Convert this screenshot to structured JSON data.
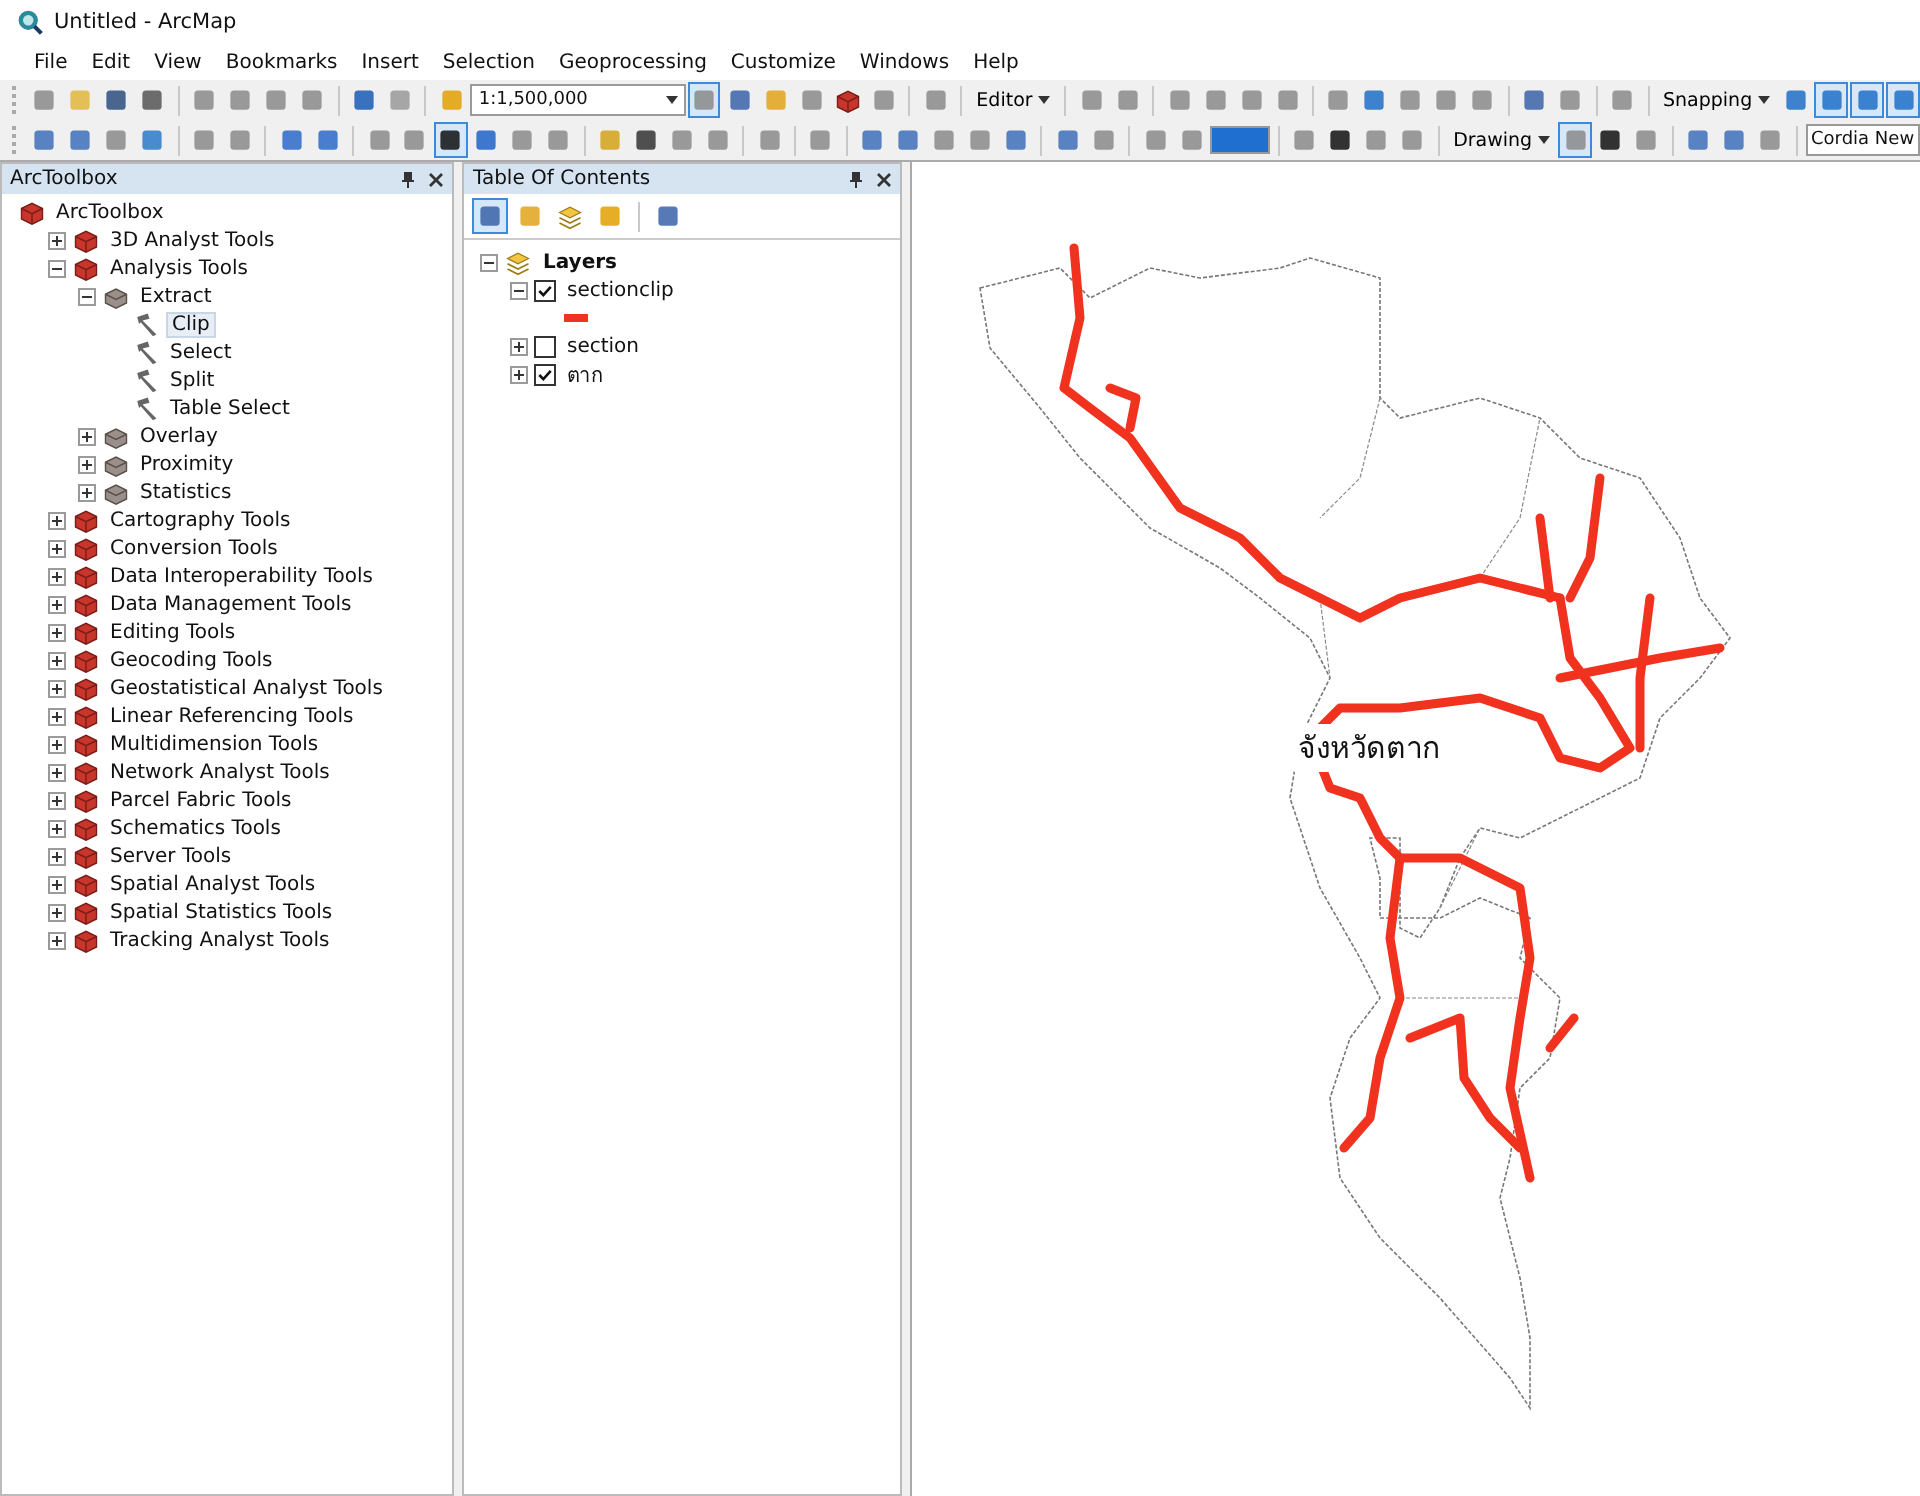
{
  "window": {
    "title": "Untitled - ArcMap"
  },
  "menu": [
    "File",
    "Edit",
    "View",
    "Bookmarks",
    "Insert",
    "Selection",
    "Geoprocessing",
    "Customize",
    "Windows",
    "Help"
  ],
  "toolbars": [
    [
      {
        "kind": "button",
        "selected": false
      },
      {
        "kind": "button",
        "selected": false
      },
      {
        "kind": "button",
        "selected": false
      },
      {
        "kind": "button",
        "selected": false
      },
      {
        "kind": "sep"
      },
      {
        "kind": "button",
        "selected": false
      },
      {
        "kind": "button",
        "selected": false
      },
      {
        "kind": "button",
        "selected": false
      },
      {
        "kind": "button",
        "selected": false
      },
      {
        "kind": "sep"
      },
      {
        "kind": "button",
        "selected": false
      },
      {
        "kind": "button",
        "selected": false
      },
      {
        "kind": "sep"
      },
      {
        "kind": "button",
        "selected": false
      },
      {
        "kind": "combo",
        "value": "1:1,500,000"
      },
      {
        "kind": "button",
        "selected": true
      },
      {
        "kind": "button",
        "selected": false
      },
      {
        "kind": "button",
        "selected": false
      },
      {
        "kind": "button",
        "selected": false
      },
      {
        "kind": "button",
        "selected": false
      },
      {
        "kind": "button",
        "selected": false
      },
      {
        "kind": "sep"
      },
      {
        "kind": "button",
        "selected": false
      },
      {
        "kind": "sep"
      },
      {
        "kind": "menu",
        "label": "Editor"
      },
      {
        "kind": "sep"
      },
      {
        "kind": "button",
        "selected": false
      },
      {
        "kind": "button",
        "selected": false
      },
      {
        "kind": "sep"
      },
      {
        "kind": "button",
        "selected": false
      },
      {
        "kind": "button",
        "selected": false
      },
      {
        "kind": "button",
        "selected": false
      },
      {
        "kind": "button",
        "selected": false
      },
      {
        "kind": "sep"
      },
      {
        "kind": "button",
        "selected": false
      },
      {
        "kind": "button",
        "selected": false
      },
      {
        "kind": "button",
        "selected": false
      },
      {
        "kind": "button",
        "selected": false
      },
      {
        "kind": "button",
        "selected": false
      },
      {
        "kind": "sep"
      },
      {
        "kind": "button",
        "selected": false
      },
      {
        "kind": "button",
        "selected": false
      },
      {
        "kind": "sep"
      },
      {
        "kind": "button",
        "selected": false
      },
      {
        "kind": "sep"
      },
      {
        "kind": "menu",
        "label": "Snapping"
      },
      {
        "kind": "button",
        "selected": false
      },
      {
        "kind": "button",
        "selected": true
      },
      {
        "kind": "button",
        "selected": true
      },
      {
        "kind": "button",
        "selected": true
      }
    ],
    [
      {
        "kind": "button",
        "selected": false
      },
      {
        "kind": "button",
        "selected": false
      },
      {
        "kind": "button",
        "selected": false
      },
      {
        "kind": "button",
        "selected": false
      },
      {
        "kind": "sep"
      },
      {
        "kind": "button",
        "selected": false
      },
      {
        "kind": "button",
        "selected": false
      },
      {
        "kind": "sep"
      },
      {
        "kind": "button",
        "selected": false
      },
      {
        "kind": "button",
        "selected": false
      },
      {
        "kind": "sep"
      },
      {
        "kind": "button",
        "selected": false
      },
      {
        "kind": "button",
        "selected": false
      },
      {
        "kind": "button",
        "selected": true
      },
      {
        "kind": "button",
        "selected": false
      },
      {
        "kind": "button",
        "selected": false
      },
      {
        "kind": "button",
        "selected": false
      },
      {
        "kind": "sep"
      },
      {
        "kind": "button",
        "selected": false
      },
      {
        "kind": "button",
        "selected": false
      },
      {
        "kind": "button",
        "selected": false
      },
      {
        "kind": "button",
        "selected": false
      },
      {
        "kind": "sep"
      },
      {
        "kind": "button",
        "selected": false
      },
      {
        "kind": "sep"
      },
      {
        "kind": "button",
        "selected": false
      },
      {
        "kind": "sep"
      },
      {
        "kind": "button",
        "selected": false
      },
      {
        "kind": "button",
        "selected": false
      },
      {
        "kind": "button",
        "selected": false
      },
      {
        "kind": "button",
        "selected": false
      },
      {
        "kind": "button",
        "selected": false
      },
      {
        "kind": "sep"
      },
      {
        "kind": "button",
        "selected": false
      },
      {
        "kind": "button",
        "selected": false
      },
      {
        "kind": "sep"
      },
      {
        "kind": "button",
        "selected": false
      },
      {
        "kind": "button",
        "selected": false
      },
      {
        "kind": "colorbox"
      },
      {
        "kind": "sep"
      },
      {
        "kind": "button",
        "selected": false
      },
      {
        "kind": "button",
        "selected": false
      },
      {
        "kind": "button",
        "selected": false
      },
      {
        "kind": "button",
        "selected": false
      },
      {
        "kind": "sep"
      },
      {
        "kind": "menu",
        "label": "Drawing"
      },
      {
        "kind": "button",
        "selected": true
      },
      {
        "kind": "button",
        "selected": false
      },
      {
        "kind": "button",
        "selected": false
      },
      {
        "kind": "sep"
      },
      {
        "kind": "button",
        "selected": false
      },
      {
        "kind": "button",
        "selected": false
      },
      {
        "kind": "button",
        "selected": false
      },
      {
        "kind": "sep"
      },
      {
        "kind": "field",
        "value": "Cordia New"
      }
    ]
  ],
  "toolbox": {
    "title": "ArcToolbox",
    "root": "ArcToolbox",
    "items": [
      {
        "kind": "toolbox",
        "label": "3D Analyst Tools",
        "expanded": false
      },
      {
        "kind": "toolbox",
        "label": "Analysis Tools",
        "expanded": true,
        "children": [
          {
            "kind": "toolset",
            "label": "Extract",
            "expanded": true,
            "children": [
              {
                "kind": "tool",
                "label": "Clip",
                "selected": true
              },
              {
                "kind": "tool",
                "label": "Select",
                "selected": false
              },
              {
                "kind": "tool",
                "label": "Split",
                "selected": false
              },
              {
                "kind": "tool",
                "label": "Table Select",
                "selected": false
              }
            ]
          },
          {
            "kind": "toolset",
            "label": "Overlay",
            "expanded": false
          },
          {
            "kind": "toolset",
            "label": "Proximity",
            "expanded": false
          },
          {
            "kind": "toolset",
            "label": "Statistics",
            "expanded": false
          }
        ]
      },
      {
        "kind": "toolbox",
        "label": "Cartography Tools",
        "expanded": false
      },
      {
        "kind": "toolbox",
        "label": "Conversion Tools",
        "expanded": false
      },
      {
        "kind": "toolbox",
        "label": "Data Interoperability Tools",
        "expanded": false
      },
      {
        "kind": "toolbox",
        "label": "Data Management Tools",
        "expanded": false
      },
      {
        "kind": "toolbox",
        "label": "Editing Tools",
        "expanded": false
      },
      {
        "kind": "toolbox",
        "label": "Geocoding Tools",
        "expanded": false
      },
      {
        "kind": "toolbox",
        "label": "Geostatistical Analyst Tools",
        "expanded": false
      },
      {
        "kind": "toolbox",
        "label": "Linear Referencing Tools",
        "expanded": false
      },
      {
        "kind": "toolbox",
        "label": "Multidimension Tools",
        "expanded": false
      },
      {
        "kind": "toolbox",
        "label": "Network Analyst Tools",
        "expanded": false
      },
      {
        "kind": "toolbox",
        "label": "Parcel Fabric Tools",
        "expanded": false
      },
      {
        "kind": "toolbox",
        "label": "Schematics Tools",
        "expanded": false
      },
      {
        "kind": "toolbox",
        "label": "Server Tools",
        "expanded": false
      },
      {
        "kind": "toolbox",
        "label": "Spatial Analyst Tools",
        "expanded": false
      },
      {
        "kind": "toolbox",
        "label": "Spatial Statistics Tools",
        "expanded": false
      },
      {
        "kind": "toolbox",
        "label": "Tracking Analyst Tools",
        "expanded": false
      }
    ]
  },
  "toc": {
    "title": "Table Of Contents",
    "frame": {
      "label": "Layers",
      "expanded": true
    },
    "layers": [
      {
        "name": "sectionclip",
        "checked": true,
        "expanded": true,
        "color": "#f0321e"
      },
      {
        "name": "section",
        "checked": false,
        "expanded": false
      },
      {
        "name": "ตาก",
        "checked": true,
        "expanded": false
      }
    ]
  },
  "map": {
    "label": "จังหวัดตาก"
  }
}
